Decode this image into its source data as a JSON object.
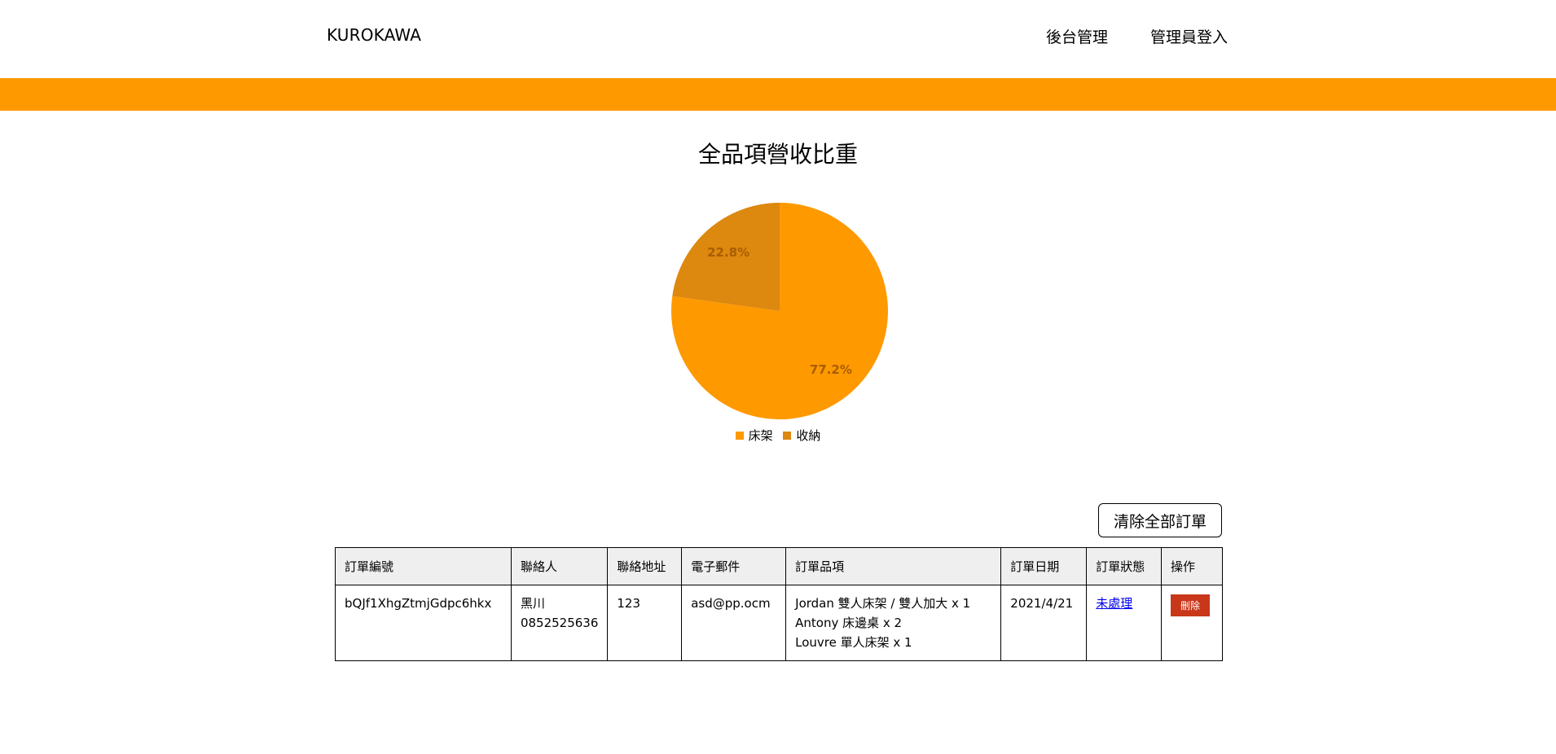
{
  "header": {
    "brand": "KUROKAWA",
    "nav": [
      {
        "label": "後台管理"
      },
      {
        "label": "管理員登入"
      }
    ]
  },
  "colors": {
    "accent": "#ff9900",
    "slice_1": "#ff9900",
    "slice_2": "#dd880f",
    "delete_button": "#c9371b"
  },
  "chart_data": {
    "type": "pie",
    "title": "全品項營收比重",
    "categories": [
      "床架",
      "收納"
    ],
    "values": [
      77.2,
      22.8
    ],
    "data_labels": [
      "77.2%",
      "22.8%"
    ],
    "legend_position": "bottom"
  },
  "toolbar": {
    "clear_all_label": "清除全部訂單"
  },
  "table": {
    "headers": [
      "訂單編號",
      "聯絡人",
      "聯絡地址",
      "電子郵件",
      "訂單品項",
      "訂單日期",
      "訂單狀態",
      "操作"
    ],
    "rows": [
      {
        "order_id": "bQJf1XhgZtmjGdpc6hkx",
        "contact_name": "黑川",
        "contact_phone": "0852525636",
        "address": "123",
        "email": "asd@pp.ocm",
        "items": [
          "Jordan 雙人床架 / 雙人加大 x 1",
          "Antony 床邊桌 x 2",
          "Louvre 單人床架 x 1"
        ],
        "date": "2021/4/21",
        "status": "未處理",
        "delete_label": "刪除"
      }
    ]
  }
}
